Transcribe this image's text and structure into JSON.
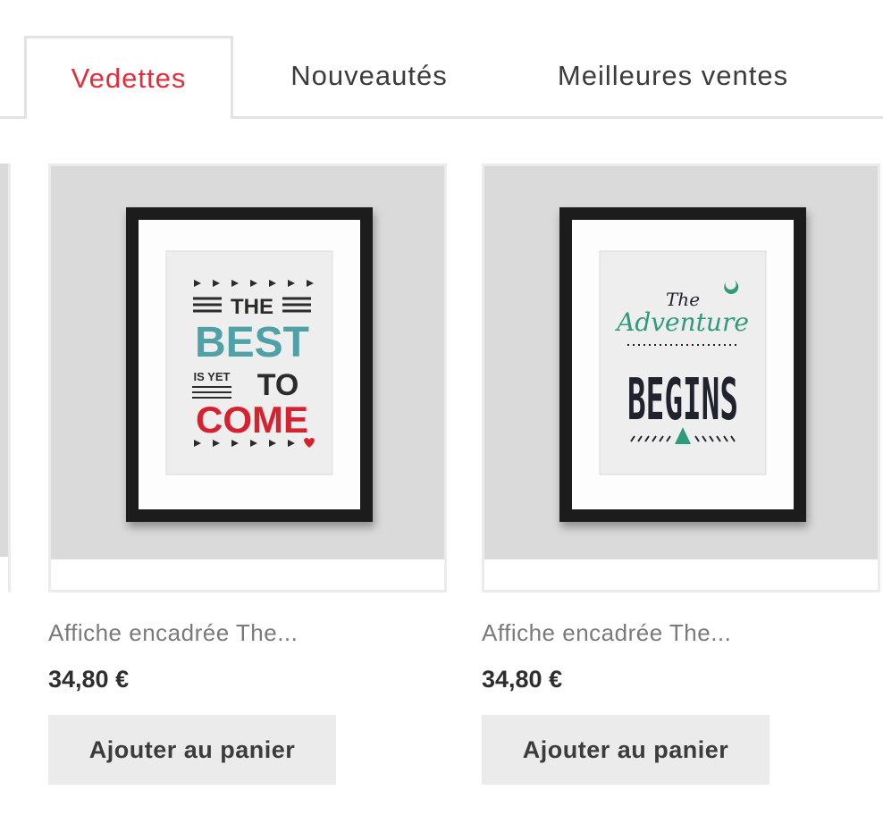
{
  "tabs": [
    {
      "label": "Vedettes",
      "active": true
    },
    {
      "label": "Nouveautés",
      "active": false
    },
    {
      "label": "Meilleures ventes",
      "active": false
    }
  ],
  "colors": {
    "accent": "#e22d3c",
    "teal": "#4fa1a8",
    "green": "#2f9b7c",
    "navy": "#20232e"
  },
  "products": [
    {
      "name": "Affiche encadrée The...",
      "price": "34,80 €",
      "button": "Ajouter au panier",
      "poster": {
        "line1": "THE",
        "line2": "BEST",
        "line3a": "IS YET",
        "line3b": "TO",
        "line4": "COME"
      }
    },
    {
      "name": "Affiche encadrée The...",
      "price": "34,80 €",
      "button": "Ajouter au panier",
      "poster": {
        "line1": "The",
        "line2": "Adventure",
        "line3": "BEGINS"
      }
    }
  ]
}
